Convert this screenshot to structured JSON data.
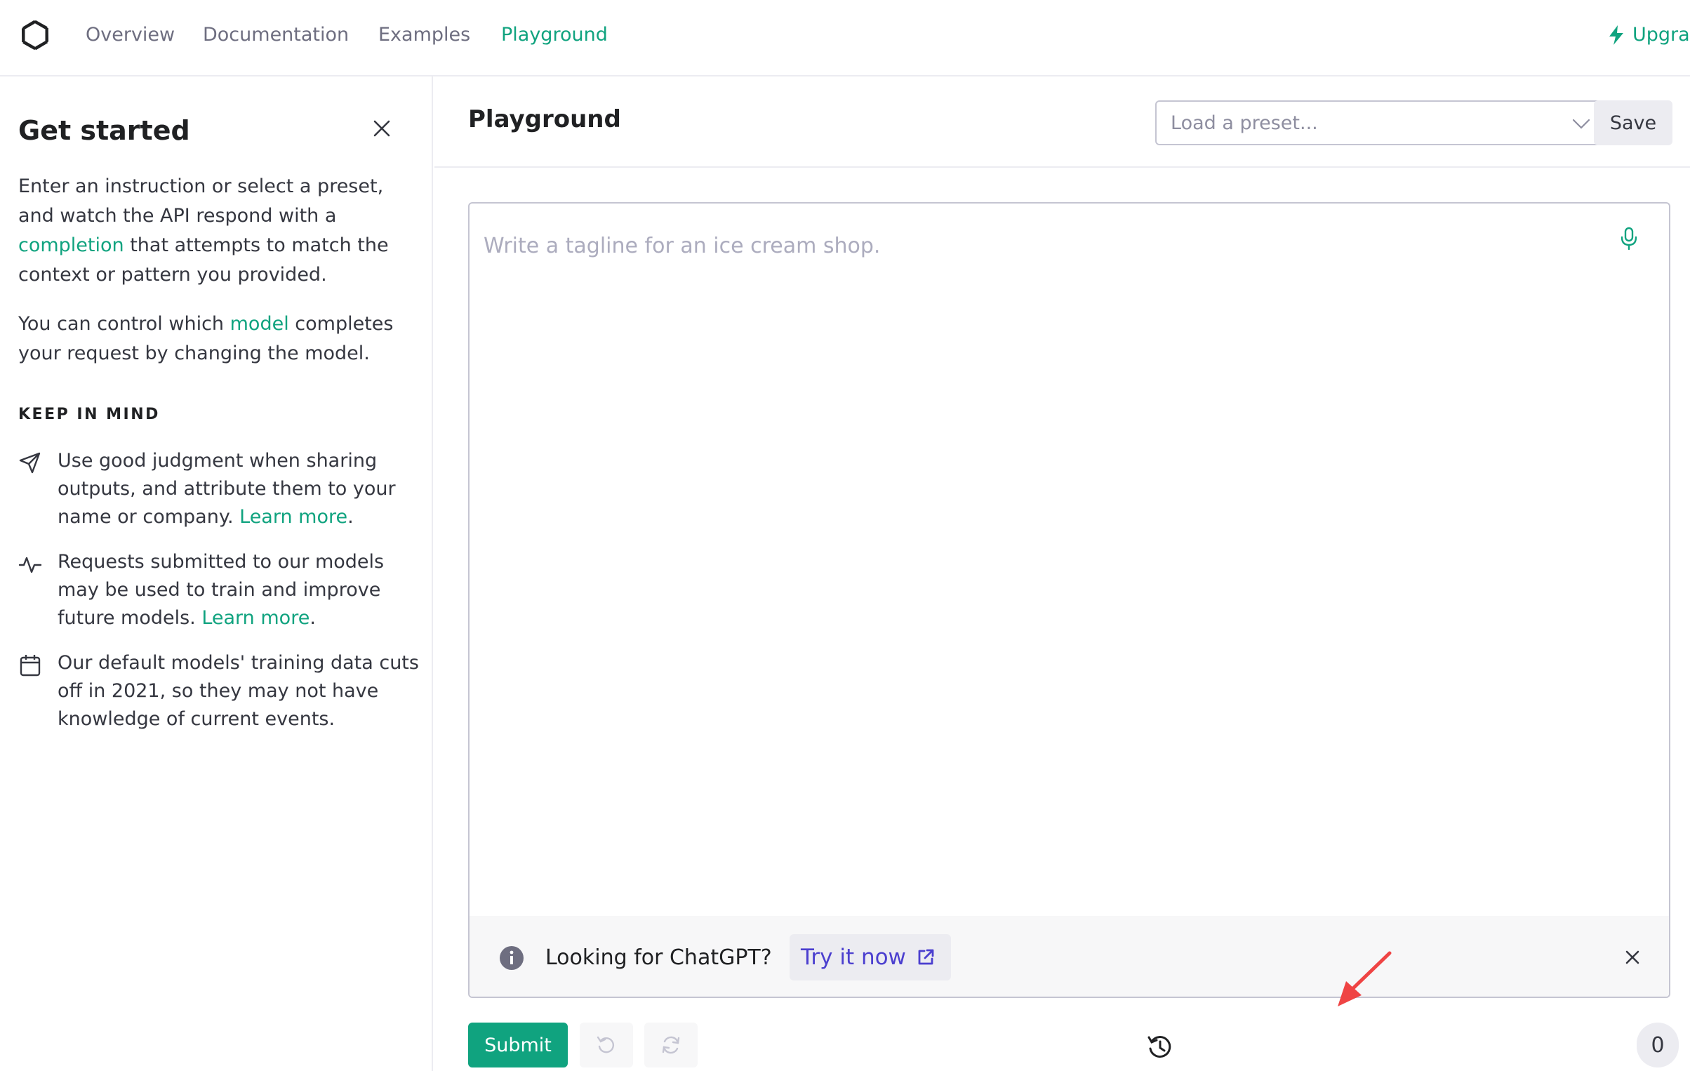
{
  "nav": {
    "links": [
      {
        "label": "Overview"
      },
      {
        "label": "Documentation"
      },
      {
        "label": "Examples"
      },
      {
        "label": "Playground"
      }
    ],
    "active": "Playground",
    "upgrade_label": "Upgrade"
  },
  "left_panel": {
    "title": "Get started",
    "intro": {
      "part1": "Enter an instruction or select a preset, and watch the API respond with a ",
      "link": "completion",
      "part2": " that attempts to match the context or pattern you provided."
    },
    "model_para": {
      "part1": "You can control which ",
      "link": "model",
      "part2": " completes your request by changing the model."
    },
    "keep_in_mind": "KEEP IN MIND",
    "tips": [
      {
        "icon": "send-icon",
        "text": "Use good judgment when sharing outputs, and attribute them to your name or company. ",
        "link": "Learn more",
        "suffix": "."
      },
      {
        "icon": "activity-icon",
        "text": "Requests submitted to our models may be used to train and improve future models. ",
        "link": "Learn more",
        "suffix": "."
      },
      {
        "icon": "calendar-icon",
        "text": "Our default models' training data cuts off in 2021, so they may not have knowledge of current events.",
        "link": "",
        "suffix": ""
      }
    ]
  },
  "main": {
    "title": "Playground",
    "preset_placeholder": "Load a preset...",
    "save_label": "Save",
    "prompt_placeholder": "Write a tagline for an ice cream shop.",
    "banner": {
      "text": "Looking for ChatGPT?",
      "cta": "Try it now"
    },
    "submit_label": "Submit",
    "token_count": "0"
  },
  "colors": {
    "accent": "#10a37f",
    "link_purple": "#4b3fcf",
    "annotation_arrow": "#ef4444"
  }
}
